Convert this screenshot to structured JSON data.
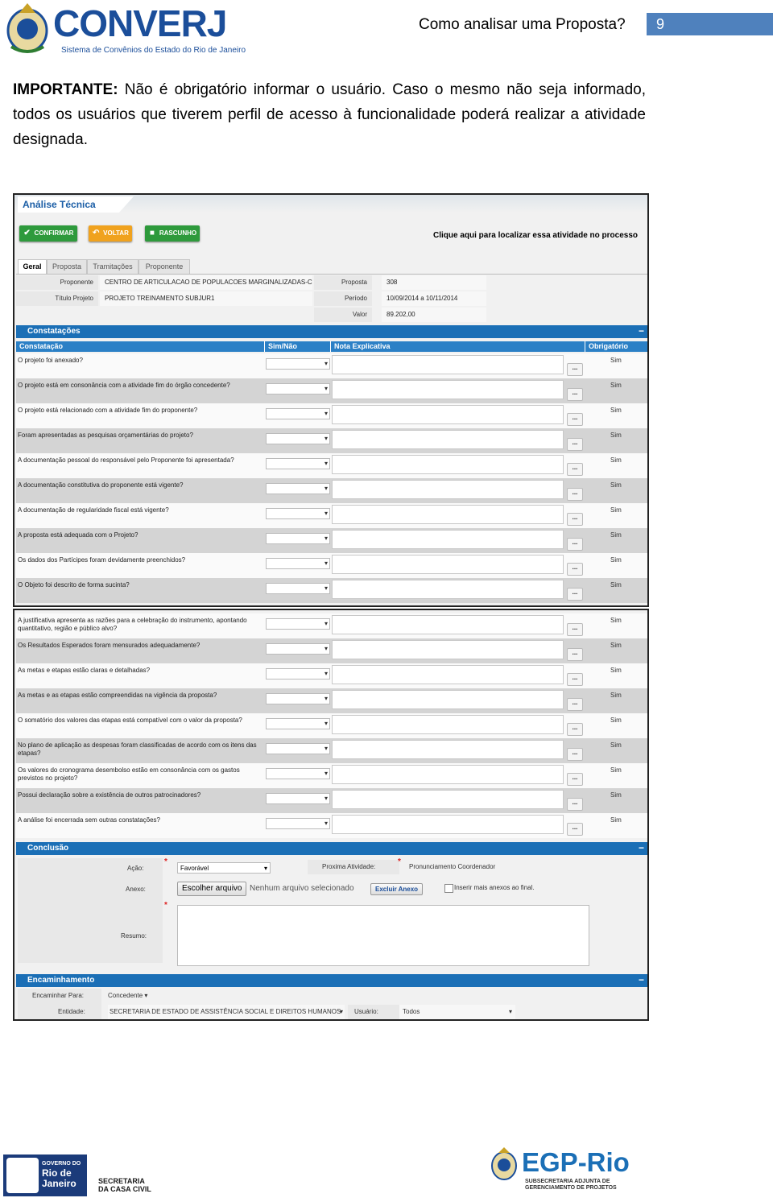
{
  "header": {
    "logo_text": "CONVERJ",
    "logo_subtitle": "Sistema de Convênios do Estado do Rio de Janeiro",
    "question": "Como analisar uma Proposta?",
    "page_number": "9"
  },
  "note": {
    "label": "IMPORTANTE:",
    "text": " Não é obrigatório informar o usuário. Caso o mesmo não seja informado, todos os usuários que tiverem perfil de acesso à funcionalidade poderá realizar a atividade designada."
  },
  "screen": {
    "title": "Análise Técnica",
    "buttons": {
      "confirmar": "CONFIRMAR",
      "voltar": "VOLTAR",
      "rascunho": "RASCUNHO"
    },
    "locate_link": "Clique aqui para localizar essa atividade no processo",
    "tabs": [
      "Geral",
      "Proposta",
      "Tramitações",
      "Proponente"
    ],
    "info": {
      "proponente_label": "Proponente",
      "proponente_value": "CENTRO DE ARTICULACAO DE POPULACOES MARGINALIZADAS-CEAP",
      "titulo_label": "Título Projeto",
      "titulo_value": "PROJETO TREINAMENTO SUBJUR1",
      "proposta_label": "Proposta",
      "proposta_value": "308",
      "periodo_label": "Período",
      "periodo_value": "10/09/2014 a 10/11/2014",
      "valor_label": "Valor",
      "valor_value": "89.202,00"
    },
    "constatacoes": {
      "title": "Constatações",
      "columns": [
        "Constatação",
        "Sim/Não",
        "Nota Explicativa",
        "Obrigatório"
      ],
      "dots_label": "...",
      "rows_part1": [
        {
          "q": "O projeto foi anexado?",
          "req": "Sim"
        },
        {
          "q": "O projeto está em consonância com a atividade fim do órgão concedente?",
          "req": "Sim"
        },
        {
          "q": "O projeto está relacionado com a atividade fim do proponente?",
          "req": "Sim"
        },
        {
          "q": "Foram apresentadas as pesquisas orçamentárias do projeto?",
          "req": "Sim"
        },
        {
          "q": "A documentação pessoal do responsável pelo Proponente foi apresentada?",
          "req": "Sim"
        },
        {
          "q": "A documentação constitutiva do proponente está vigente?",
          "req": "Sim"
        },
        {
          "q": "A documentação de regularidade fiscal está vigente?",
          "req": "Sim"
        },
        {
          "q": "A proposta está adequada com o Projeto?",
          "req": "Sim"
        },
        {
          "q": "Os dados dos Partícipes foram devidamente preenchidos?",
          "req": "Sim"
        },
        {
          "q": "O Objeto foi descrito de forma sucinta?",
          "req": "Sim"
        }
      ],
      "rows_part2": [
        {
          "q": "A justificativa apresenta as razões para a celebração do instrumento, apontando quantitativo, região e público alvo?",
          "req": "Sim"
        },
        {
          "q": "Os Resultados Esperados foram mensurados adequadamente?",
          "req": "Sim"
        },
        {
          "q": "As metas e etapas estão claras e detalhadas?",
          "req": "Sim"
        },
        {
          "q": "As metas e as etapas estão compreendidas na vigência da proposta?",
          "req": "Sim"
        },
        {
          "q": "O somatório dos valores das etapas está compatível com o valor da proposta?",
          "req": "Sim"
        },
        {
          "q": "No plano de aplicação as despesas foram classificadas de acordo com os itens das etapas?",
          "req": "Sim"
        },
        {
          "q": "Os valores do cronograma desembolso estão em consonância com os gastos previstos no projeto?",
          "req": "Sim"
        },
        {
          "q": "Possui declaração sobre a existência de outros patrocinadores?",
          "req": "Sim"
        },
        {
          "q": "A análise foi encerrada sem outras constatações?",
          "req": "Sim"
        }
      ]
    },
    "conclusao": {
      "title": "Conclusão",
      "acao_label": "Ação:",
      "acao_value": "Favorável",
      "proxima_label": "Proxima Atividade:",
      "proxima_value": "Pronunciamento Coordenador",
      "anexo_label": "Anexo:",
      "file_button": "Escolher arquivo",
      "file_status": "Nenhum arquivo selecionado",
      "excluir_button": "Excluir Anexo",
      "inserir_label": "Inserir mais anexos ao final.",
      "resumo_label": "Resumo:"
    },
    "encaminhamento": {
      "title": "Encaminhamento",
      "encaminhar_label": "Encaminhar Para:",
      "encaminhar_value": "Concedente",
      "entidade_label": "Entidade:",
      "entidade_value": "SECRETARIA DE ESTADO DE ASSISTÊNCIA SOCIAL E DIREITOS HUMANOS",
      "usuario_label": "Usuário:",
      "usuario_value": "Todos"
    }
  },
  "footer": {
    "gov_small": "GOVERNO DO",
    "gov_big": "Rio de Janeiro",
    "secretaria": "SECRETARIA",
    "casa_civil": "DA CASA CIVIL",
    "egp_name": "EGP-Rio",
    "egp_sub1": "SUBSECRETARIA ADJUNTA DE",
    "egp_sub2": "GERENCIAMENTO DE PROJETOS"
  },
  "colors": {
    "brand": "#1b4e9a",
    "accent_bar": "#4f81bd",
    "section_blue": "#1b6fb6",
    "green_button": "#2e9a3c",
    "orange_button": "#f0a21e"
  },
  "icons": [
    "crest-icon",
    "check-icon",
    "back-arrow-icon",
    "save-icon",
    "dropdown-arrow-icon"
  ]
}
